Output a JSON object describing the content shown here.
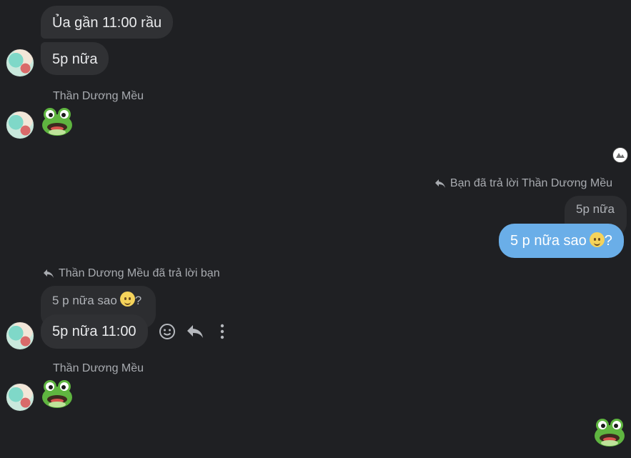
{
  "contact_name": "Thần Dương Mều",
  "messages": {
    "m1": "Ủa gần 11:00 rầu",
    "m2": "5p nữa",
    "m3_sender": "Thần Dương Mều",
    "m3_sticker": "frog-emoji",
    "my_reply_label": "Bạn đã trả lời Thần Dương Mều",
    "my_reply_quote": "5p nữa",
    "my_message": "5 p nữa sao",
    "my_message_suffix": "?",
    "their_reply_label": "Thần Dương Mều đã trả lời bạn",
    "their_reply_quote": "5 p nữa sao",
    "their_reply_quote_suffix": "?",
    "their_message": "5p nữa 11:00",
    "m5_sender": "Thần Dương Mều",
    "m5_sticker": "frog-emoji",
    "my_sticker": "frog-emoji"
  },
  "actions": [
    "react-icon",
    "reply-icon",
    "more-icon"
  ],
  "colors": {
    "background": "#1f2023",
    "incoming_bubble": "#303134",
    "outgoing_bubble": "#6aaee8",
    "secondary_text": "#a8abb0"
  }
}
